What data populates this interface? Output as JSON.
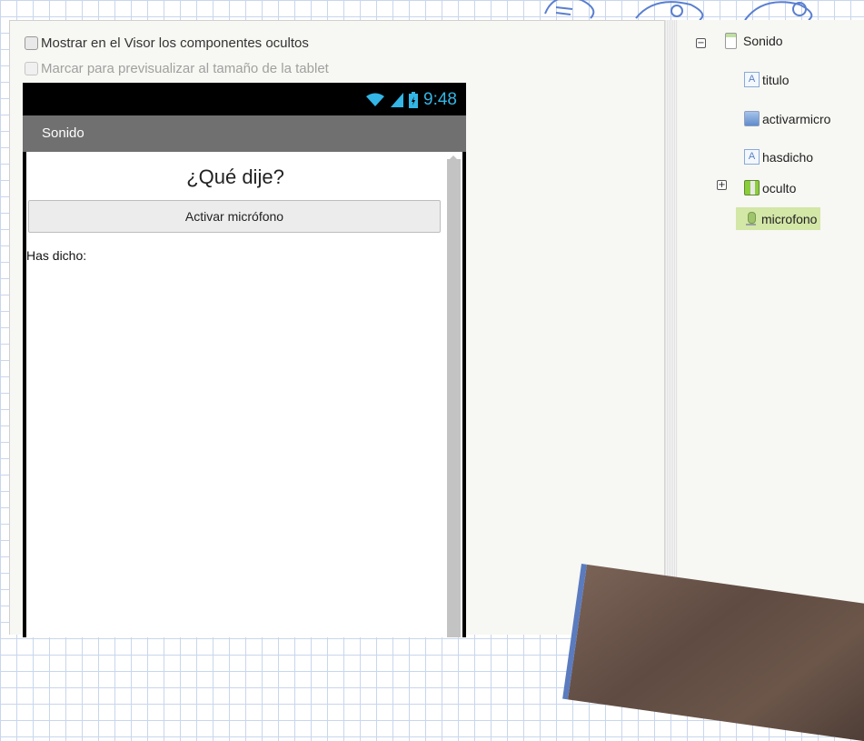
{
  "options": {
    "show_hidden_label": "Mostrar en el Visor los componentes ocultos",
    "tablet_preview_label": "Marcar para previsualizar al tamaño de la tablet"
  },
  "phone": {
    "status_time": "9:48",
    "screen_title": "Sonido",
    "heading": "¿Qué dije?",
    "button_label": "Activar micrófono",
    "said_label": "Has dicho:"
  },
  "tree": {
    "root": "Sonido",
    "items": [
      {
        "label": "titulo",
        "icon": "label-icon"
      },
      {
        "label": "activarmicro",
        "icon": "button-icon"
      },
      {
        "label": "hasdicho",
        "icon": "label-icon"
      },
      {
        "label": "oculto",
        "icon": "arrangement-icon",
        "collapsed": true
      },
      {
        "label": "microfono",
        "icon": "microphone-icon",
        "selected": true
      }
    ]
  },
  "colors": {
    "status_accent": "#33b5e5",
    "title_bar": "#707070",
    "selected_row": "#d3e7a7"
  }
}
